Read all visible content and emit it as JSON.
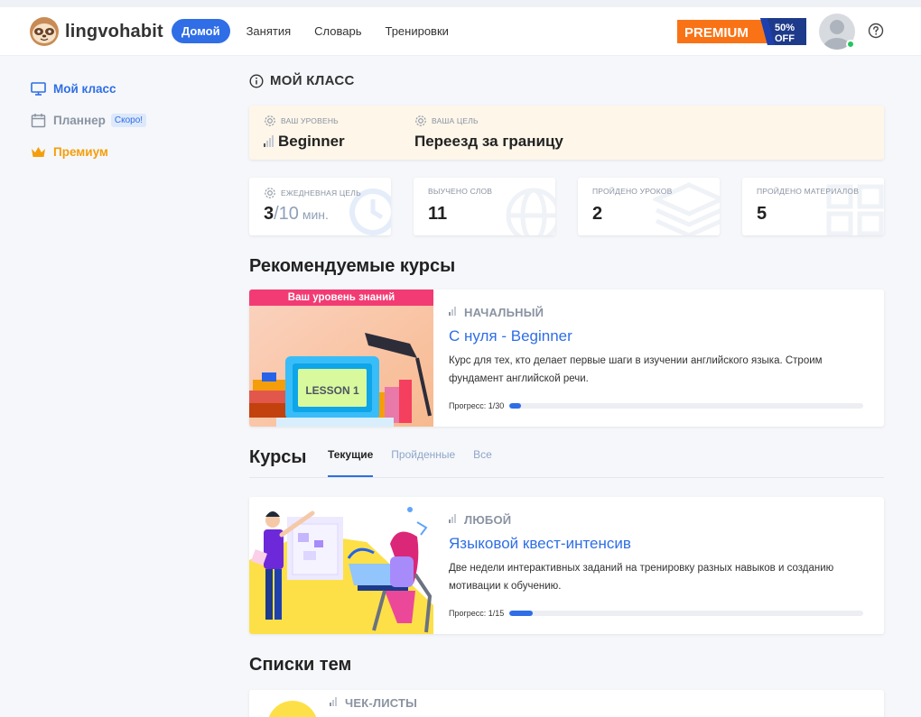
{
  "header": {
    "logo_text": "lingvohabit",
    "nav": [
      {
        "label": "Домой",
        "active": true
      },
      {
        "label": "Занятия",
        "active": false
      },
      {
        "label": "Словарь",
        "active": false
      },
      {
        "label": "Тренировки",
        "active": false
      }
    ],
    "premium_label": "PREMIUM",
    "discount_line1": "50%",
    "discount_line2": "OFF",
    "online_color": "#22c55e"
  },
  "sidebar": {
    "items": [
      {
        "label": "Мой класс",
        "icon": "monitor-icon",
        "color": "#2f6ee6"
      },
      {
        "label": "Планнер",
        "icon": "calendar-icon",
        "color": "#8a93a2",
        "badge": "Скоро!"
      },
      {
        "label": "Премиум",
        "icon": "crown-icon",
        "color": "#f59e0b"
      }
    ]
  },
  "my_class": {
    "title": "МОЙ КЛАСС",
    "level_label": "ВАШ УРОВЕНЬ",
    "level_value": "Beginner",
    "goal_label": "ВАША ЦЕЛЬ",
    "goal_value": "Переезд за границу"
  },
  "stats": [
    {
      "label": "ЕЖЕДНЕВНАЯ ЦЕЛЬ",
      "value": "3",
      "total": "/10",
      "unit": " мин.",
      "icon": "clock-icon"
    },
    {
      "label": "ВЫУЧЕНО СЛОВ",
      "value": "11",
      "icon": "globe-icon"
    },
    {
      "label": "ПРОЙДЕНО УРОКОВ",
      "value": "2",
      "icon": "layers-icon"
    },
    {
      "label": "ПРОЙДЕНО МАТЕРИАЛОВ",
      "value": "5",
      "icon": "grid-icon"
    }
  ],
  "recommended": {
    "heading": "Рекомендуемые курсы",
    "ribbon": "Ваш уровень знаний",
    "image_text": "LESSON 1",
    "level": "НАЧАЛЬНЫЙ",
    "title": "С нуля - Beginner",
    "description": "Курс для тех, кто делает первые шаги в изучении английского языка. Строим фундамент английской речи.",
    "progress_label": "Прогресс: 1/30",
    "progress_fraction": 0.0333
  },
  "courses": {
    "heading": "Курсы",
    "tabs": [
      {
        "label": "Текущие",
        "active": true
      },
      {
        "label": "Пройденные",
        "active": false
      },
      {
        "label": "Все",
        "active": false
      }
    ],
    "item": {
      "level": "ЛЮБОЙ",
      "title": "Языковой квест-интенсив",
      "description": "Две недели интерактивных заданий на тренировку разных навыков и созданию мотивации к обучению.",
      "progress_label": "Прогресс: 1/15",
      "progress_fraction": 0.0667
    }
  },
  "topics": {
    "heading": "Списки тем",
    "first_item_level": "ЧЕК-ЛИСТЫ"
  }
}
